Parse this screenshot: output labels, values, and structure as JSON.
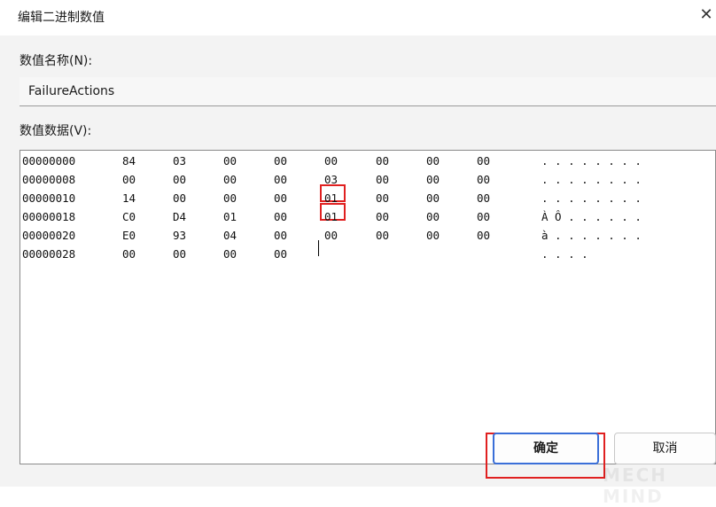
{
  "window": {
    "title": "编辑二进制数值",
    "close_glyph": "✕"
  },
  "value_name": {
    "label": "数值名称(N):",
    "value": "FailureActions"
  },
  "value_data": {
    "label": "数值数据(V):",
    "rows": [
      {
        "offset": "00000000",
        "bytes": [
          "84",
          "03",
          "00",
          "00",
          "00",
          "00",
          "00",
          "00"
        ],
        "ascii": ". . . . . . . ."
      },
      {
        "offset": "00000008",
        "bytes": [
          "00",
          "00",
          "00",
          "00",
          "03",
          "00",
          "00",
          "00"
        ],
        "ascii": ". . . . . . . ."
      },
      {
        "offset": "00000010",
        "bytes": [
          "14",
          "00",
          "00",
          "00",
          "01",
          "00",
          "00",
          "00"
        ],
        "ascii": ". . . . . . . ."
      },
      {
        "offset": "00000018",
        "bytes": [
          "C0",
          "D4",
          "01",
          "00",
          "01",
          "00",
          "00",
          "00"
        ],
        "ascii": "À Ô . . . . . ."
      },
      {
        "offset": "00000020",
        "bytes": [
          "E0",
          "93",
          "04",
          "00",
          "00",
          "00",
          "00",
          "00"
        ],
        "ascii": "à . . . . . . ."
      },
      {
        "offset": "00000028",
        "bytes": [
          "00",
          "00",
          "00",
          "00"
        ],
        "ascii": ". . . ."
      }
    ]
  },
  "buttons": {
    "ok": "确定",
    "cancel": "取消"
  },
  "watermark": "MECH MIND",
  "colors": {
    "highlight": "#e02020",
    "ok_border": "#3a6fd8",
    "content_bg": "#f3f3f3"
  }
}
